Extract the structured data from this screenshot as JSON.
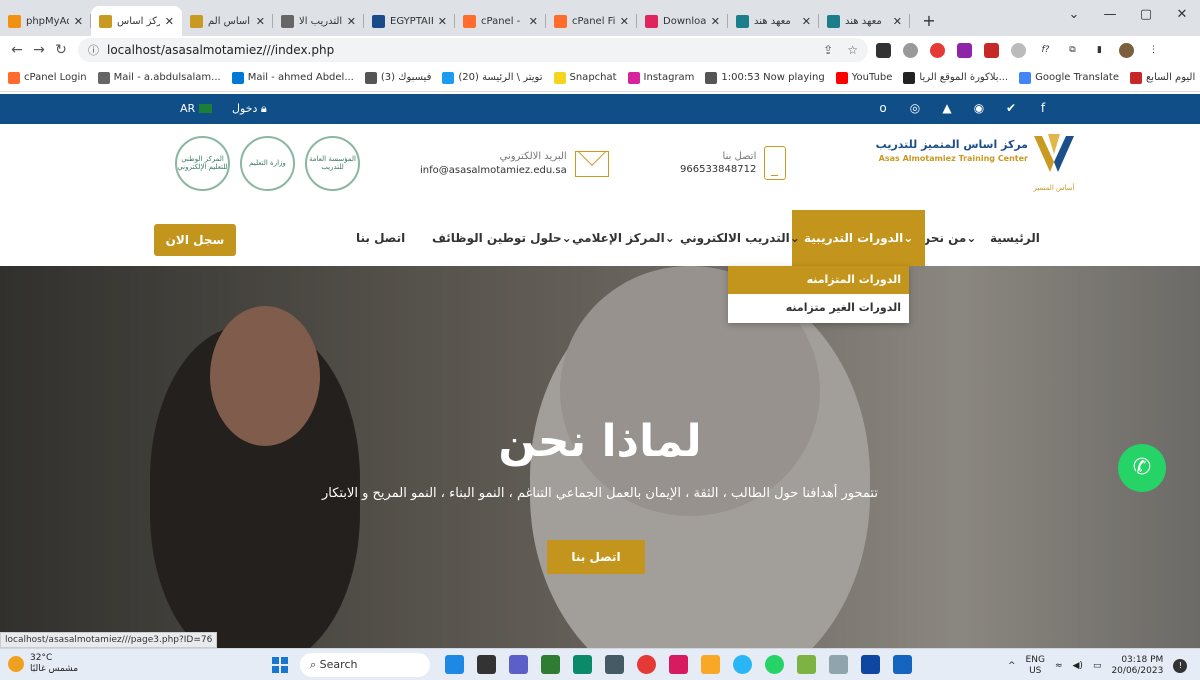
{
  "browser": {
    "tabs": [
      {
        "title": "phpMyAd",
        "color": "#f29111",
        "active": false
      },
      {
        "title": "مركز اساس",
        "color": "#c89a22",
        "active": true
      },
      {
        "title": "أساس الم",
        "color": "#c89a22",
        "active": false
      },
      {
        "title": "التدريب الا",
        "color": "#666666",
        "active": false
      },
      {
        "title": "EGYPTAIR",
        "color": "#1a4c8a",
        "active": false
      },
      {
        "title": "cPanel - N",
        "color": "#ff6c2c",
        "active": false
      },
      {
        "title": "cPanel File",
        "color": "#ff6c2c",
        "active": false
      },
      {
        "title": "Download",
        "color": "#e0245e",
        "active": false
      },
      {
        "title": "معهد هند",
        "color": "#1a7f8a",
        "active": false
      },
      {
        "title": "معهد هند",
        "color": "#1a7f8a",
        "active": false
      }
    ],
    "new_tab": "+",
    "url": "localhost/asasalmotamiez///index.php",
    "bookmarks": [
      {
        "label": "cPanel Login",
        "color": "#ff6c2c"
      },
      {
        "label": "Mail - a.abdulsalam...",
        "color": "#666666"
      },
      {
        "label": "Mail - ahmed Abdel...",
        "color": "#0078d4"
      },
      {
        "label": "(3) فيسبوك",
        "color": "#555555"
      },
      {
        "label": "(20) تويتر \\ الرئيسة",
        "color": "#1d9bf0"
      },
      {
        "label": "Snapchat",
        "color": "#f7d51d"
      },
      {
        "label": "Instagram",
        "color": "#d6249f"
      },
      {
        "label": "1:00:53 Now playing",
        "color": "#555555"
      },
      {
        "label": "YouTube",
        "color": "#ff0000"
      },
      {
        "label": "بلاكورة الموقع الريا...",
        "color": "#222222"
      },
      {
        "label": "Google Translate",
        "color": "#4285f4"
      },
      {
        "label": "اليوم السابع",
        "color": "#c62828"
      }
    ],
    "bookmarks_more": "»",
    "status_url": "localhost/asasalmotamiez///page3.php?ID=76"
  },
  "site": {
    "topbar": {
      "lang": "AR",
      "login": "دخول",
      "social": [
        "o",
        "◎",
        "▲",
        "◉",
        "✔",
        "f"
      ]
    },
    "header": {
      "email_label": "البريد الالكتروني",
      "email": "info@asasalmotamiez.edu.sa",
      "phone_label": "اتصل بنا",
      "phone": "966533848712",
      "brand_ar": "مركز اساس المتميز للتدريب",
      "brand_en": "Asas Almotamiez Training Center",
      "logo_caption": "أساس المتميز",
      "seal_1": "المركز الوطني للتعليم الإلكتروني",
      "seal_2": "وزارة التعليم",
      "seal_3": "المؤسسة العامة للتدريب"
    },
    "menu": {
      "home": "الرئيسية",
      "about": "من نحن",
      "courses": "الدورات التدريبية",
      "elearning": "التدريب الالكتروني",
      "media": "المركز الإعلامي",
      "jobs": "حلول توطين الوظائف",
      "contact": "اتصل بنا",
      "register": "سجل الان"
    },
    "dropdown": {
      "sync": "الدورات المتزامنه",
      "async": "الدورات الغير متزامنه"
    },
    "hero": {
      "title": "لماذا نحن",
      "subtitle": "تتمحور أهدافنا حول الطالب ، الثقة ، الإيمان بالعمل الجماعي التناغم ، النمو البناء ، النمو المريح و الابتكار",
      "button": "اتصل بنا"
    }
  },
  "taskbar": {
    "temp": "32°C",
    "weather": "مشمس غالبًا",
    "search": "Search",
    "lang1": "ENG",
    "lang2": "US",
    "time": "03:18 PM",
    "date": "20/06/2023"
  }
}
